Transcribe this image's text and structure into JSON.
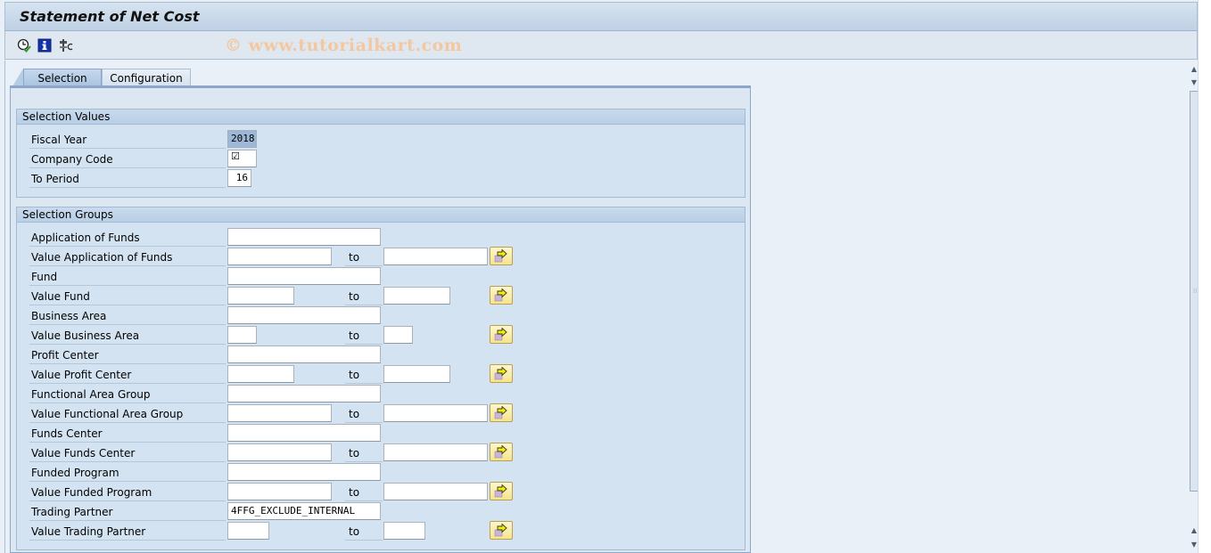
{
  "title": "Statement of Net Cost",
  "watermark": "© www.tutorialkart.com",
  "toolbar": {
    "icons": [
      "execute-clock-icon",
      "info-icon",
      "program-variants-icon"
    ]
  },
  "tabs": [
    {
      "label": "Selection",
      "active": true
    },
    {
      "label": "Configuration",
      "active": false
    }
  ],
  "selection_values": {
    "header": "Selection Values",
    "fiscal_year_label": "Fiscal Year",
    "fiscal_year_value": "2018",
    "company_code_label": "Company Code",
    "company_code_value": "☑",
    "to_period_label": "To Period",
    "to_period_value": "16"
  },
  "selection_groups": {
    "header": "Selection Groups",
    "to_label": "to",
    "rows": [
      {
        "label": "Application of Funds",
        "value": ""
      },
      {
        "label": "Value Application of Funds",
        "from": "",
        "to": ""
      },
      {
        "label": "Fund",
        "value": ""
      },
      {
        "label": "Value Fund",
        "from": "",
        "to": ""
      },
      {
        "label": "Business Area",
        "value": ""
      },
      {
        "label": "Value Business Area",
        "from": "",
        "to": ""
      },
      {
        "label": "Profit Center",
        "value": ""
      },
      {
        "label": "Value Profit Center",
        "from": "",
        "to": ""
      },
      {
        "label": "Functional Area Group",
        "value": ""
      },
      {
        "label": "Value Functional Area Group",
        "from": "",
        "to": ""
      },
      {
        "label": "Funds Center",
        "value": ""
      },
      {
        "label": "Value Funds Center",
        "from": "",
        "to": ""
      },
      {
        "label": "Funded Program",
        "value": ""
      },
      {
        "label": "Value Funded Program",
        "from": "",
        "to": ""
      },
      {
        "label": "Trading Partner",
        "value": "4FFG_EXCLUDE_INTERNAL"
      },
      {
        "label": "Value Trading Partner",
        "from": "",
        "to": ""
      }
    ]
  }
}
